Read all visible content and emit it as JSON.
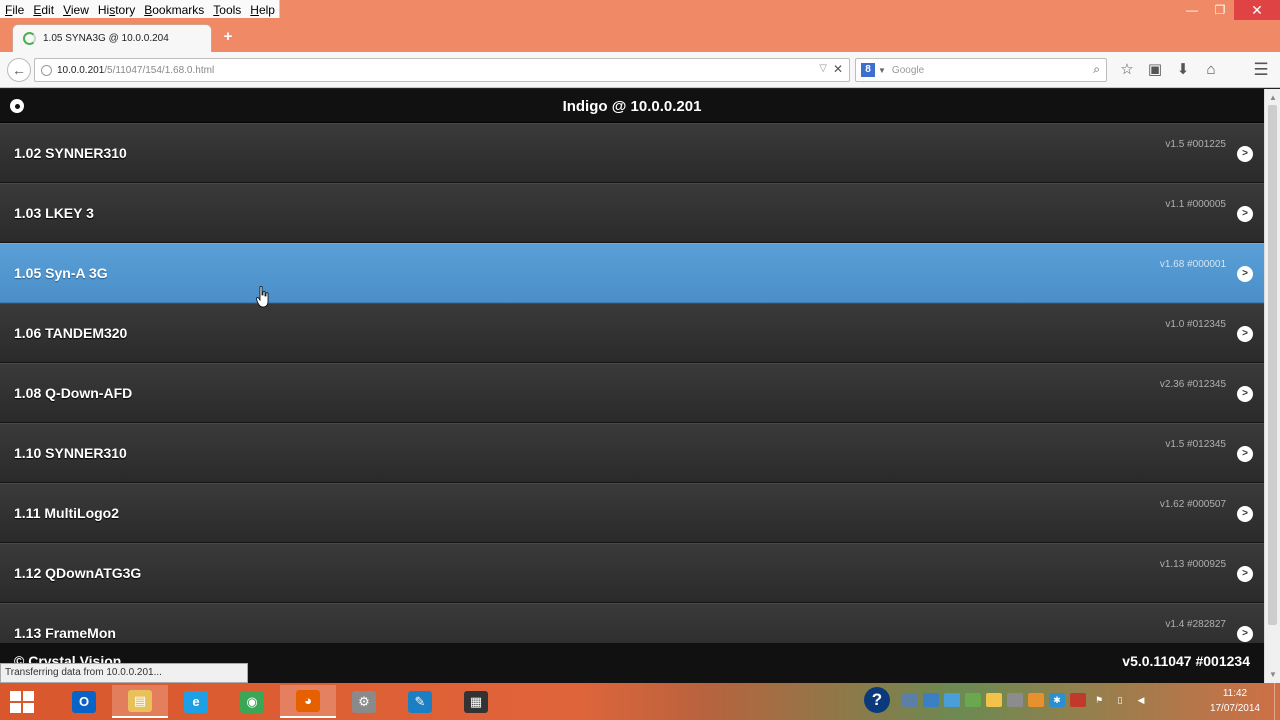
{
  "browser": {
    "menu": [
      {
        "key": "F",
        "rest": "ile"
      },
      {
        "key": "E",
        "rest": "dit"
      },
      {
        "key": "V",
        "rest": "iew"
      },
      {
        "key": "",
        "pre": "Hi",
        "keyMid": "s",
        "rest": "tory"
      },
      {
        "key": "B",
        "rest": "ookmarks"
      },
      {
        "key": "T",
        "rest": "ools"
      },
      {
        "key": "H",
        "rest": "elp"
      }
    ],
    "tab_title": "1.05 SYNA3G @ 10.0.0.204",
    "new_tab": "+",
    "url_host": "10.0.0.201",
    "url_path": "/5/11047/154/1.68.0.html",
    "search_engine_letter": "8",
    "search_placeholder": "Google",
    "status_text": "Transferring data from 10.0.0.201..."
  },
  "page": {
    "title": "Indigo @ 10.0.0.201",
    "items": [
      {
        "label": "1.02 SYNNER310",
        "version": "v1.5 #001225",
        "selected": false
      },
      {
        "label": "1.03 LKEY 3",
        "version": "v1.1 #000005",
        "selected": false
      },
      {
        "label": "1.05 Syn-A 3G",
        "version": "v1.68 #000001",
        "selected": true
      },
      {
        "label": "1.06 TANDEM320",
        "version": "v1.0 #012345",
        "selected": false
      },
      {
        "label": "1.08 Q-Down-AFD",
        "version": "v2.36 #012345",
        "selected": false
      },
      {
        "label": "1.10 SYNNER310",
        "version": "v1.5 #012345",
        "selected": false
      },
      {
        "label": "1.11 MultiLogo2",
        "version": "v1.62 #000507",
        "selected": false
      },
      {
        "label": "1.12 QDownATG3G",
        "version": "v1.13 #000925",
        "selected": false
      },
      {
        "label": "1.13 FrameMon",
        "version": "v1.4 #282827",
        "selected": false
      }
    ],
    "footer_left": "© Crystal Vision",
    "footer_right": "v5.0.11047 #001234"
  },
  "taskbar": {
    "apps": [
      {
        "name": "outlook",
        "glyph": "O",
        "color": "#0a64c8",
        "active": false
      },
      {
        "name": "file-explorer",
        "glyph": "▤",
        "color": "#e8c15a",
        "active": true
      },
      {
        "name": "internet-explorer",
        "glyph": "e",
        "color": "#1ea0e6",
        "active": false
      },
      {
        "name": "chrome",
        "glyph": "◉",
        "color": "#3aa757",
        "active": false
      },
      {
        "name": "firefox",
        "glyph": "◕",
        "color": "#e66000",
        "active": true
      },
      {
        "name": "network-tool",
        "glyph": "⚙",
        "color": "#8a8a8a",
        "active": false
      },
      {
        "name": "pen-app",
        "glyph": "✎",
        "color": "#1c7fc4",
        "active": false
      },
      {
        "name": "snipping-tool",
        "glyph": "▦",
        "color": "#333333",
        "active": false
      }
    ],
    "time": "11:42",
    "date": "17/07/2014"
  }
}
